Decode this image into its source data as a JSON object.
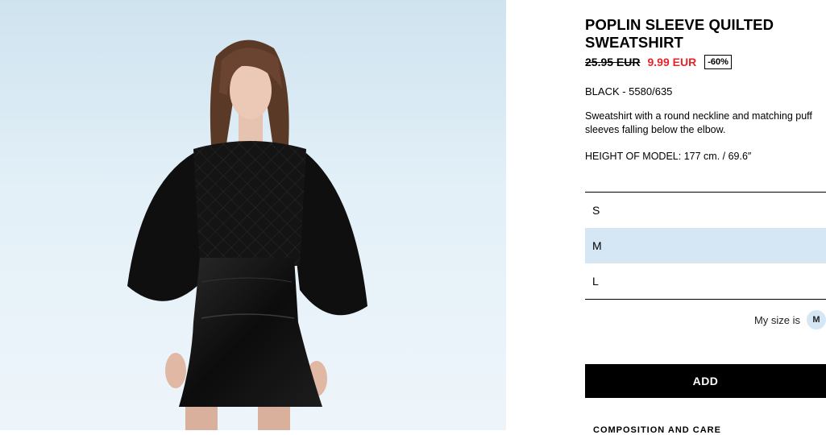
{
  "product": {
    "title_line1": "POPLIN SLEEVE QUILTED",
    "title_line2": "SWEATSHIRT",
    "old_price": "25.95 EUR",
    "new_price": "9.99 EUR",
    "discount": "-60%",
    "color_ref": "BLACK - 5580/635",
    "description": "Sweatshirt with a round neckline and matching puff sleeves falling below the elbow.",
    "model_height": "HEIGHT OF MODEL: 177 cm. / 69.6″"
  },
  "sizes": {
    "options": [
      "S",
      "M",
      "L"
    ],
    "selected": "M"
  },
  "my_size": {
    "label": "My size is",
    "value": "M"
  },
  "actions": {
    "add_label": "ADD",
    "next_section_label": "COMPOSITION AND CARE"
  },
  "colors": {
    "sale_red": "#e4262b",
    "selected_bg": "#d5e6f5",
    "photo_bg": "#dcebf5"
  }
}
